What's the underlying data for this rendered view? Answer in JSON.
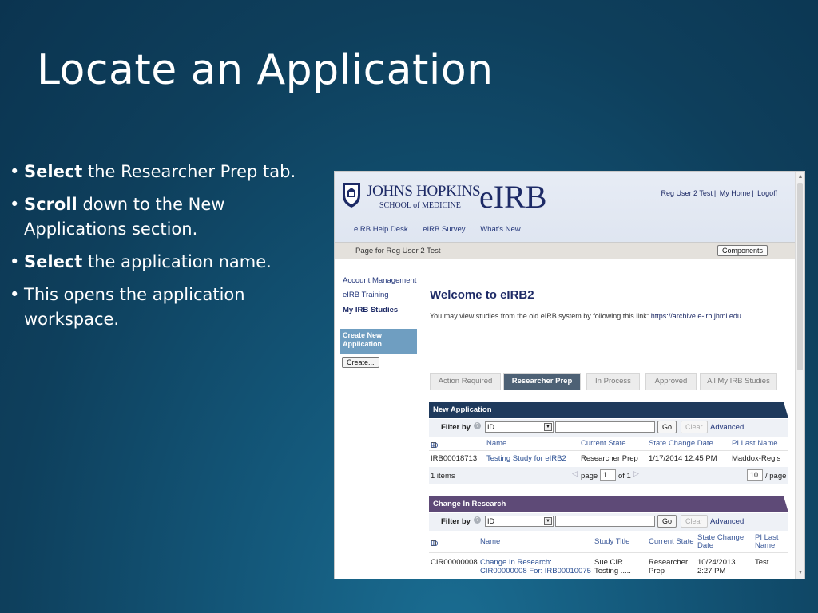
{
  "slide": {
    "title": "Locate an Application",
    "bullets": [
      {
        "bold": "Select",
        "rest": " the Researcher Prep tab."
      },
      {
        "bold": "Scroll",
        "rest": " down to the New Applications section."
      },
      {
        "bold": "Select",
        "rest": " the application name."
      },
      {
        "bold": "",
        "rest": "This opens the application workspace."
      }
    ]
  },
  "app": {
    "org_line1": "JOHNS HOPKINS",
    "org_line2": "SCHOOL of MEDICINE",
    "app_name": "eIRB",
    "user_links": [
      "Reg User 2 Test",
      "My Home",
      "Logoff"
    ],
    "top_nav": [
      "eIRB Help Desk",
      "eIRB Survey",
      "What's New"
    ],
    "page_title": "Page for Reg User 2 Test",
    "components_label": "Components",
    "sidebar": {
      "links": [
        "Account Management",
        "eIRB Training",
        "My IRB Studies"
      ],
      "create_heading": "Create New Application",
      "create_button": "Create..."
    },
    "welcome": "Welcome to eIRB2",
    "intro_text": "You may view studies from the old eIRB system by following this link: ",
    "intro_link": "https://archive.e-irb.jhmi.edu.",
    "tabs": [
      "Action Required",
      "Researcher Prep",
      "In Process",
      "Approved",
      "All My IRB Studies"
    ],
    "active_tab": "Researcher Prep",
    "new_application": {
      "title": "New Application",
      "filter_label": "Filter by",
      "filter_field": "ID",
      "go": "Go",
      "clear": "Clear",
      "advanced": "Advanced",
      "columns": [
        "ID",
        "Name",
        "Current State",
        "State Change Date",
        "PI Last Name"
      ],
      "rows": [
        {
          "id": "IRB00018713",
          "name": "Testing Study for eIRB2",
          "state": "Researcher Prep",
          "date": "1/17/2014 12:45 PM",
          "pi": "Maddox-Regis"
        }
      ],
      "items": "1 items",
      "page_label": "page",
      "page_value": "1",
      "of_label": "of 1",
      "per_page": "10",
      "per_page_label": "/ page"
    },
    "change_in_research": {
      "title": "Change In Research",
      "filter_label": "Filter by",
      "filter_field": "ID",
      "go": "Go",
      "clear": "Clear",
      "advanced": "Advanced",
      "columns": [
        "ID",
        "Name",
        "Study Title",
        "Current State",
        "State Change Date",
        "PI Last Name"
      ],
      "rows": [
        {
          "id": "CIR00000008",
          "name": "Change In Research: CIR00000008 For: IRB00010075",
          "title": "Sue CIR Testing .....",
          "state": "Researcher Prep",
          "date": "10/24/2013 2:27 PM",
          "pi": "Test"
        }
      ]
    }
  }
}
